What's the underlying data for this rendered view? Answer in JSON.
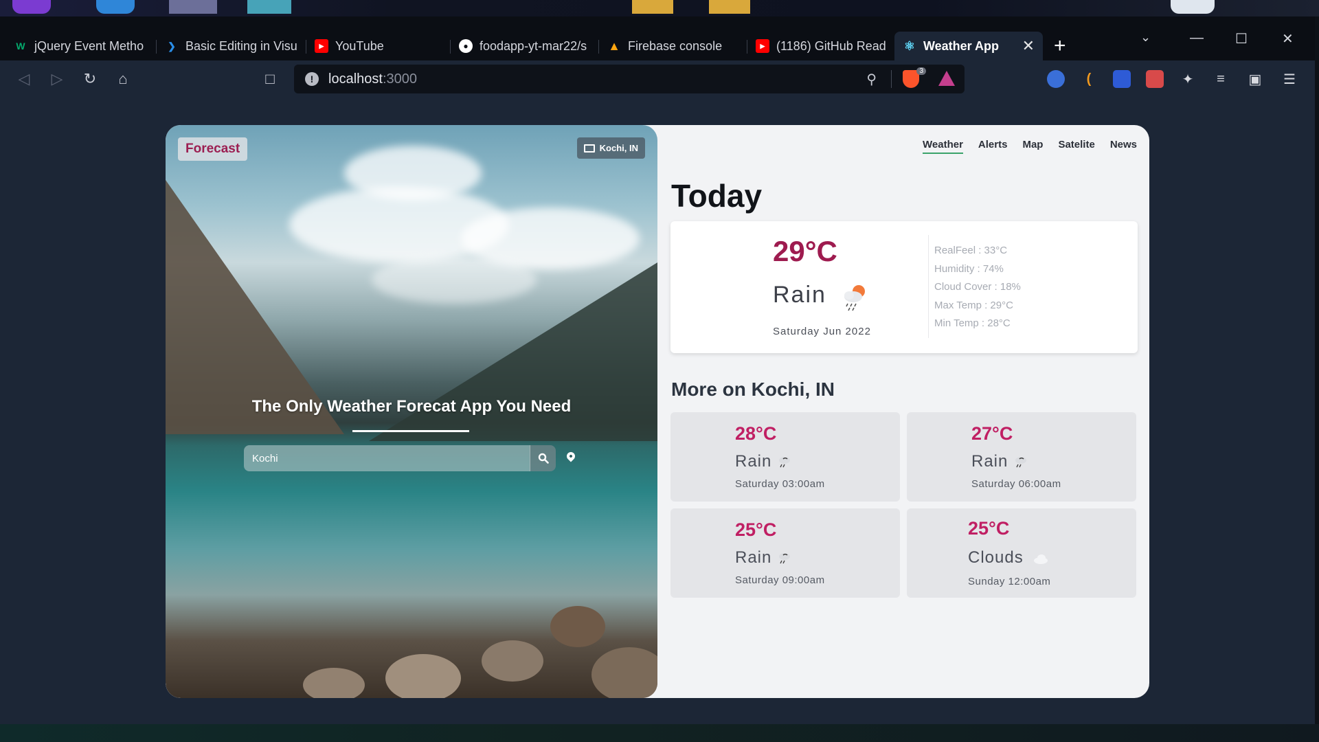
{
  "browser": {
    "tabs": [
      {
        "label": "jQuery Event Metho",
        "favicon": "w3schools-icon",
        "fav_color": "#04aa6d",
        "active": false
      },
      {
        "label": "Basic Editing in Visu",
        "favicon": "vscode-icon",
        "fav_color": "#2a8ee8",
        "active": false
      },
      {
        "label": "YouTube",
        "favicon": "youtube-icon",
        "fav_color": "#ff0000",
        "active": false
      },
      {
        "label": "foodapp-yt-mar22/s",
        "favicon": "github-icon",
        "fav_color": "#ffffff",
        "active": false
      },
      {
        "label": "Firebase console",
        "favicon": "firebase-icon",
        "fav_color": "#ffa611",
        "active": false
      },
      {
        "label": "(1186) GitHub Read",
        "favicon": "youtube-icon",
        "fav_color": "#ff0000",
        "active": false
      },
      {
        "label": "Weather App",
        "favicon": "react-icon",
        "fav_color": "#61dafb",
        "active": true
      }
    ],
    "url_host": "localhost",
    "url_port": ":3000",
    "shields_count": "3"
  },
  "app": {
    "forecast_button": "Forecast",
    "location_badge": "Kochi, IN",
    "hero_title": "The Only Weather Forecat App You Need",
    "search_value": "Kochi",
    "nav": [
      "Weather",
      "Alerts",
      "Map",
      "Satelite",
      "News"
    ],
    "today_title": "Today",
    "today": {
      "temp": "29°C",
      "condition": "Rain",
      "date": "Saturday Jun 2022",
      "details": [
        "RealFeel : 33°C",
        "Humidity : 74%",
        "Cloud Cover : 18%",
        "Max Temp : 29°C",
        "Min Temp : 28°C"
      ]
    },
    "more_title": "More on Kochi, IN",
    "forecasts": [
      {
        "temp": "28°C",
        "condition": "Rain",
        "time": "Saturday 03:00am",
        "icon": "rain-icon"
      },
      {
        "temp": "27°C",
        "condition": "Rain",
        "time": "Saturday 06:00am",
        "icon": "rain-icon"
      },
      {
        "temp": "25°C",
        "condition": "Rain",
        "time": "Saturday 09:00am",
        "icon": "rain-icon"
      },
      {
        "temp": "25°C",
        "condition": "Clouds",
        "time": "Sunday 12:00am",
        "icon": "cloud-icon"
      }
    ]
  },
  "colors": {
    "accent_temp": "#9e1b4f",
    "accent_small_temp": "#c01f63",
    "nav_active_underline": "#3aa36a",
    "page_bg": "#1c2636"
  }
}
